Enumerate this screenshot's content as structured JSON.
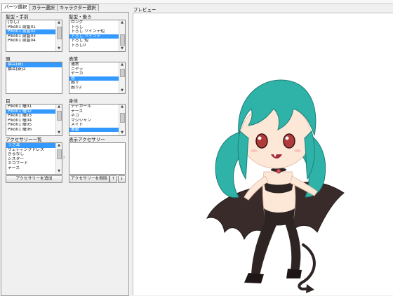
{
  "tabs": [
    "パーツ選択",
    "カラー選択",
    "キャラクター選択"
  ],
  "preview_label": "プレビュー",
  "hair_front": {
    "label": "髪型・手前",
    "items": [
      "(なし)",
      "Piko01 前髪01",
      "Piko01 前髪02",
      "Piko01 前髪03",
      "Piko01 前髪04"
    ],
    "selected_index": 2
  },
  "hair_back": {
    "label": "髪型・後ろ",
    "items": [
      "ロング",
      "下ろし",
      "下ろし ツインテ短",
      "下ろし ツインテ",
      "下ろし 短",
      "下ろし0"
    ],
    "selected_index": 3
  },
  "head": {
    "label": "頭",
    "items": [
      "猫耳(新)",
      "猫耳(新)2"
    ],
    "selected_index": 0
  },
  "expression": {
    "label": "表情",
    "items": [
      "通常",
      "ニヤッ",
      "ヤーカ",
      "怒",
      "困り",
      "困り2"
    ],
    "selected_index": 3
  },
  "eyes": {
    "label": "目",
    "items": [
      "Piko01 瞳01",
      "Piko01 瞳02",
      "Piko01 瞳03",
      "Piko01 瞳04",
      "Piko01 瞳05",
      "Piko01 瞳06"
    ],
    "selected_index": 1
  },
  "body": {
    "label": "身体",
    "items": [
      "テデガール",
      "ナース",
      "ネコ",
      "マジシャン",
      "メイド",
      "悪魔"
    ],
    "selected_index": 5
  },
  "accessories": {
    "label": "アクセサリー一覧",
    "items": [
      "うさ耳",
      "ウェディングドレス",
      "ぎるなし",
      "シスター",
      "ネコフード",
      "ナース"
    ],
    "selected_index": 0
  },
  "display_accessories": {
    "label": "表示アクセサリー",
    "items": []
  },
  "buttons": {
    "add_accessory": "アクセサリーを追加",
    "remove_accessory": "アクセサリーを削除",
    "move_up": "↑",
    "move_down": "↓"
  },
  "colors": {
    "hair": "#2fb3a8",
    "hair_dark": "#1d7f78",
    "outfit": "#2e2424",
    "wing": "#3a2b2b",
    "skin": "#fde7d6",
    "eye": "#b13a3a",
    "selection": "#3399ff"
  }
}
